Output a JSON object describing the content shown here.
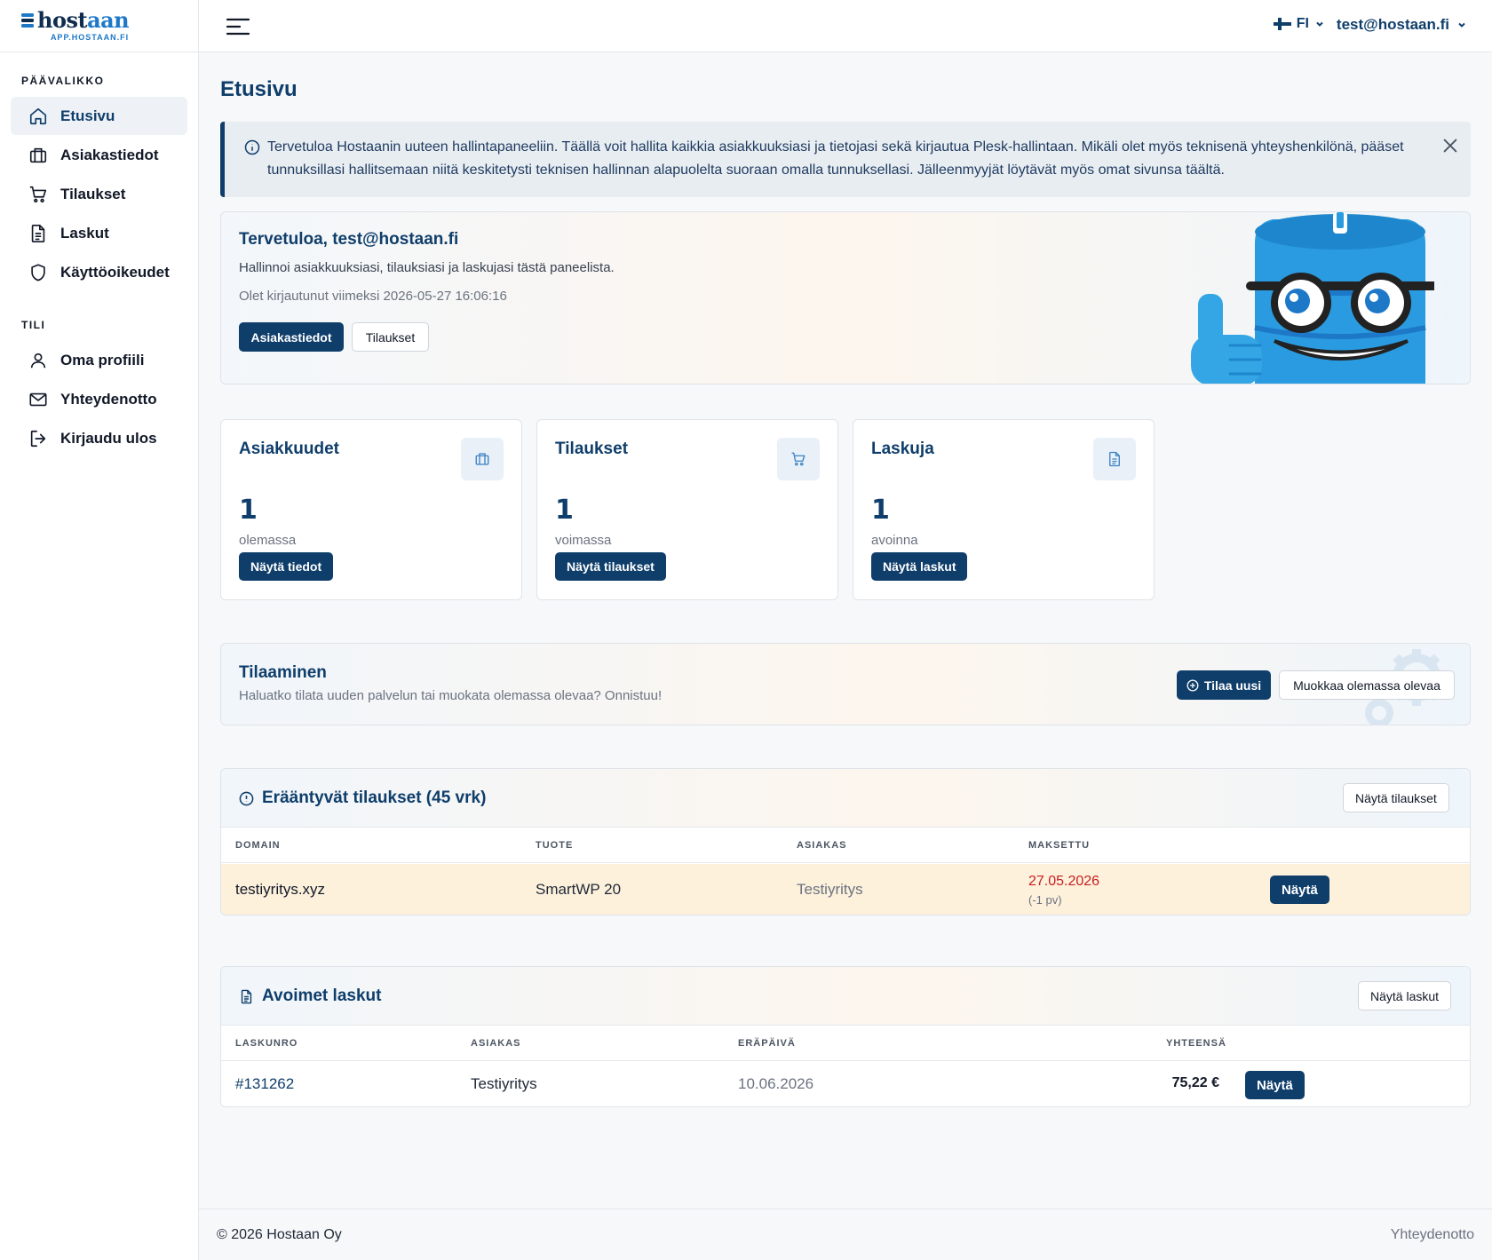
{
  "brand": {
    "name_part1": "host",
    "name_part2": "aan",
    "subtitle": "APP.HOSTAAN.FI"
  },
  "sidebar": {
    "main_label": "PÄÄVALIKKO",
    "main_items": [
      {
        "label": "Etusivu",
        "icon": "home-icon",
        "active": true
      },
      {
        "label": "Asiakastiedot",
        "icon": "briefcase-icon"
      },
      {
        "label": "Tilaukset",
        "icon": "cart-icon"
      },
      {
        "label": "Laskut",
        "icon": "document-icon"
      },
      {
        "label": "Käyttöoikeudet",
        "icon": "shield-icon"
      }
    ],
    "account_label": "TILI",
    "account_items": [
      {
        "label": "Oma profiili",
        "icon": "user-icon"
      },
      {
        "label": "Yhteydenotto",
        "icon": "mail-icon"
      },
      {
        "label": "Kirjaudu ulos",
        "icon": "logout-icon"
      }
    ]
  },
  "header": {
    "language": "FI",
    "user_email": "test@hostaan.fi"
  },
  "page": {
    "title": "Etusivu"
  },
  "alert": {
    "text": "Tervetuloa Hostaanin uuteen hallintapaneeliin. Täällä voit hallita kaikkia asiakkuuksiasi ja tietojasi sekä kirjautua Plesk-hallintaan. Mikäli olet myös teknisenä yhteyshenkilönä, pääset tunnuksillasi hallitsemaan niitä keskitetysti teknisen hallinnan alapuolelta suoraan omalla tunnuksellasi. Jälleenmyyjät löytävät myös omat sivunsa täältä."
  },
  "welcome": {
    "title": "Tervetuloa, test@hostaan.fi",
    "text": "Hallinnoi asiakkuuksiasi, tilauksiasi ja laskujasi tästä paneelista.",
    "last_login": "Olet kirjautunut viimeksi 2026-05-27 16:06:16",
    "button_primary": "Asiakastiedot",
    "button_secondary": "Tilaukset"
  },
  "stats": [
    {
      "title": "Asiakkuudet",
      "value": "1",
      "subtitle": "olemassa",
      "button": "Näytä tiedot",
      "icon": "briefcase-icon"
    },
    {
      "title": "Tilaukset",
      "value": "1",
      "subtitle": "voimassa",
      "button": "Näytä tilaukset",
      "icon": "cart-icon"
    },
    {
      "title": "Laskuja",
      "value": "1",
      "subtitle": "avoinna",
      "button": "Näytä laskut",
      "icon": "document-icon"
    }
  ],
  "ordering": {
    "title": "Tilaaminen",
    "text": "Haluatko tilata uuden palvelun tai muokata olemassa olevaa? Onnistuu!",
    "button_new": "Tilaa uusi",
    "button_edit": "Muokkaa olemassa olevaa"
  },
  "expiring": {
    "title": "Erääntyvät tilaukset (45 vrk)",
    "button": "Näytä tilaukset",
    "columns": [
      "DOMAIN",
      "TUOTE",
      "ASIAKAS",
      "MAKSETTU"
    ],
    "rows": [
      {
        "domain": "testiyritys.xyz",
        "product": "SmartWP 20",
        "customer": "Testiyritys",
        "paid": "27.05.2026",
        "paid_note": "(-1 pv)",
        "action": "Näytä"
      }
    ]
  },
  "invoices": {
    "title": "Avoimet laskut",
    "button": "Näytä laskut",
    "columns": [
      "LASKUNRO",
      "ASIAKAS",
      "ERÄPÄIVÄ",
      "YHTEENSÄ"
    ],
    "rows": [
      {
        "number": "#131262",
        "customer": "Testiyritys",
        "due": "10.06.2026",
        "total": "75,22 €",
        "action": "Näytä"
      }
    ]
  },
  "footer": {
    "copyright": "© 2026 Hostaan Oy",
    "contact": "Yhteydenotto"
  },
  "colors": {
    "primary": "#0f3e6b",
    "accent": "#1e78c8",
    "warning_row": "#fdf1dc",
    "danger": "#c81e1e"
  }
}
